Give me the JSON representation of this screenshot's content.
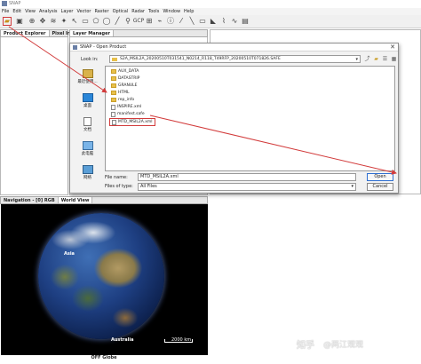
{
  "app": {
    "title": "SNAP"
  },
  "menu": [
    "File",
    "Edit",
    "View",
    "Analysis",
    "Layer",
    "Vector",
    "Raster",
    "Optical",
    "Radar",
    "Tools",
    "Window",
    "Help"
  ],
  "toolbar": {
    "icons": [
      "open-product-icon",
      "save-icon",
      "zoom-icon",
      "pan-icon",
      "layers-icon",
      "magic-wand-icon",
      "pin-icon",
      "gcp-icon",
      "rectangle-icon",
      "polygon-icon",
      "line-icon",
      "ellipse-icon",
      "select-icon",
      "range-finder-icon",
      "graph-icon"
    ],
    "gcp_label": "GCP"
  },
  "panels": {
    "left_tabs": [
      "Product Explorer",
      "Pixel Info"
    ],
    "right_tabs": [
      "Layer Manager"
    ],
    "nav_tabs": [
      "Navigation - [0] RGB",
      "World View"
    ]
  },
  "dialog": {
    "title": "SNAP - Open Product",
    "look_in_label": "Look in:",
    "look_in_value": "S2A_MSIL2A_20200510T031541_N0214_R118_T49RFP_20200510T071826.SAFE",
    "places": [
      {
        "icon": "recent-icon",
        "label": "最近使用..."
      },
      {
        "icon": "desktop-icon",
        "label": "桌面"
      },
      {
        "icon": "documents-icon",
        "label": "文档"
      },
      {
        "icon": "computer-icon",
        "label": "此电脑"
      },
      {
        "icon": "network-icon",
        "label": "网络"
      }
    ],
    "files": [
      {
        "type": "folder",
        "name": "AUX_DATA"
      },
      {
        "type": "folder",
        "name": "DATASTRIP"
      },
      {
        "type": "folder",
        "name": "GRANULE"
      },
      {
        "type": "folder",
        "name": "HTML"
      },
      {
        "type": "folder",
        "name": "rep_info"
      },
      {
        "type": "file",
        "name": "INSPIRE.xml"
      },
      {
        "type": "file",
        "name": "manifest.safe"
      },
      {
        "type": "file",
        "name": "MTD_MSIL2A.xml",
        "selected": true
      }
    ],
    "file_name_label": "File name:",
    "file_name_value": "MTD_MSIL2A.xml",
    "file_type_label": "Files of type:",
    "file_type_value": "All Files",
    "open_button": "Open",
    "cancel_button": "Cancel"
  },
  "world_view": {
    "labels": [
      "Asia",
      "Australia"
    ],
    "scale_text": "2000 km",
    "caption": "OFF Globe"
  },
  "watermark": {
    "logo": "知乎",
    "text": "@两江观观"
  },
  "colors": {
    "annotation_red": "#d23b3b",
    "folder_yellow": "#e8c04a",
    "button_focus": "#2f6fd1"
  }
}
